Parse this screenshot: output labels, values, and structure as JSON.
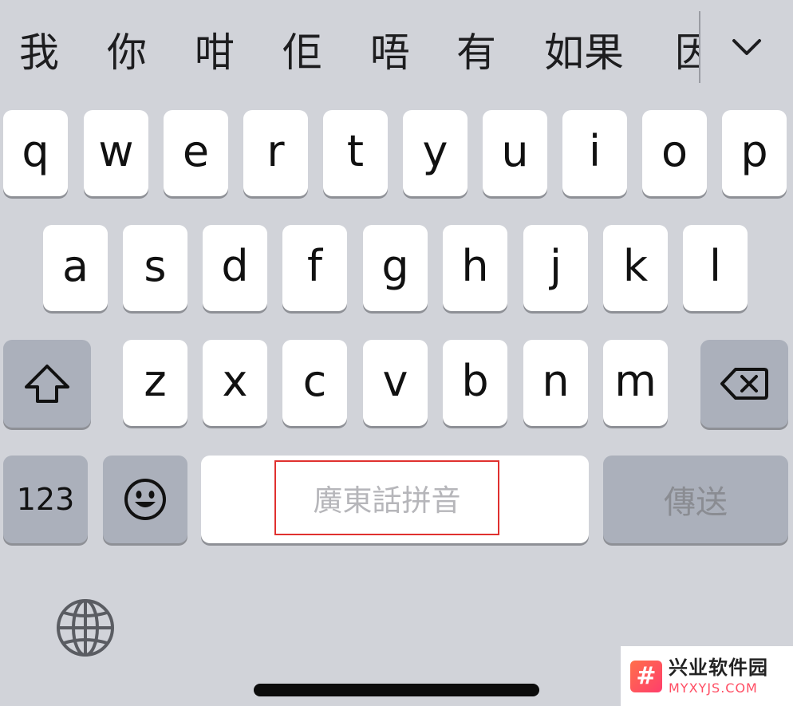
{
  "candidates": [
    {
      "text": "我",
      "id": "1"
    },
    {
      "text": "你",
      "id": "2"
    },
    {
      "text": "咁",
      "id": "3"
    },
    {
      "text": "佢",
      "id": "4"
    },
    {
      "text": "唔",
      "id": "5"
    },
    {
      "text": "有",
      "id": "6"
    },
    {
      "text": "如果",
      "id": "7"
    },
    {
      "text": "因",
      "id": "8"
    }
  ],
  "collapse_icon": "chevron-down-icon",
  "rows": {
    "row1": [
      "q",
      "w",
      "e",
      "r",
      "t",
      "y",
      "u",
      "i",
      "o",
      "p"
    ],
    "row2": [
      "a",
      "s",
      "d",
      "f",
      "g",
      "h",
      "j",
      "k",
      "l"
    ],
    "row3": [
      "z",
      "x",
      "c",
      "v",
      "b",
      "n",
      "m"
    ]
  },
  "keys": {
    "shift_icon": "shift-icon",
    "delete_icon": "delete-icon",
    "numbers_label": "123",
    "emoji_icon": "emoji-icon",
    "space_label": "廣東話拼音",
    "send_label": "傳送",
    "globe_icon": "globe-icon"
  },
  "colors": {
    "keyboard_bg": "#d1d3d9",
    "key_light": "#ffffff",
    "key_dark": "#abb0bb",
    "highlight": "#e0312f"
  },
  "watermark": {
    "title": "兴业软件园",
    "subtitle": "MYXYJS.COM",
    "logo_glyph": "#"
  }
}
